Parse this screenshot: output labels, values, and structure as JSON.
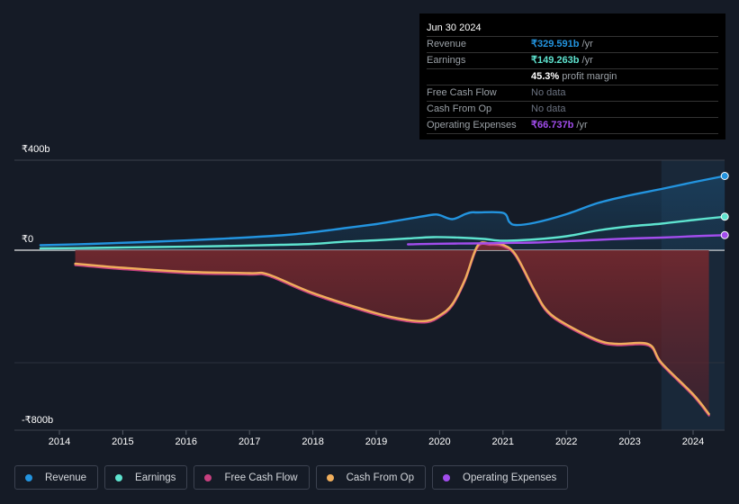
{
  "tooltip": {
    "date": "Jun 30 2024",
    "rows": [
      {
        "label": "Revenue",
        "value": "₹329.591b",
        "suffix": " /yr",
        "color": "#2394df"
      },
      {
        "label": "Earnings",
        "value": "₹149.263b",
        "suffix": " /yr",
        "color": "#5ee3cf"
      },
      {
        "label": "",
        "value": "45.3%",
        "suffix": " profit margin",
        "color": "#ffffff"
      },
      {
        "label": "Free Cash Flow",
        "value": "",
        "suffix": "No data",
        "color": "#6b7280"
      },
      {
        "label": "Cash From Op",
        "value": "",
        "suffix": "No data",
        "color": "#6b7280"
      },
      {
        "label": "Operating Expenses",
        "value": "₹66.737b",
        "suffix": " /yr",
        "color": "#a24ded"
      }
    ]
  },
  "legend": [
    {
      "label": "Revenue",
      "color": "#2394df"
    },
    {
      "label": "Earnings",
      "color": "#5ee3cf"
    },
    {
      "label": "Free Cash Flow",
      "color": "#c7407f"
    },
    {
      "label": "Cash From Op",
      "color": "#f0ae5c"
    },
    {
      "label": "Operating Expenses",
      "color": "#a24ded"
    }
  ],
  "chart_data": {
    "type": "line",
    "title": "",
    "xlabel": "",
    "ylabel": "",
    "y_tick_labels": [
      "₹400b",
      "₹0",
      "-₹800b"
    ],
    "y_ticks": [
      400,
      0,
      -800
    ],
    "ylim": [
      -800,
      400
    ],
    "x_tick_labels": [
      "2014",
      "2015",
      "2016",
      "2017",
      "2018",
      "2019",
      "2020",
      "2021",
      "2022",
      "2023",
      "2024"
    ],
    "xlim": [
      2013.2,
      2024.55
    ],
    "forecast_shade_start": 2023.5,
    "grid": true,
    "series": [
      {
        "name": "Revenue",
        "color": "#2394df",
        "x": [
          2013.7,
          2014.5,
          2015.5,
          2016.5,
          2017.5,
          2018,
          2018.5,
          2019,
          2019.3,
          2019.6,
          2019.9,
          2020.0,
          2020.2,
          2020.4,
          2020.5,
          2020.6,
          2021.0,
          2021.1,
          2021.2,
          2021.5,
          2022,
          2022.5,
          2023,
          2023.5,
          2024,
          2024.5
        ],
        "values": [
          22,
          28,
          38,
          50,
          66,
          80,
          98,
          116,
          130,
          144,
          158,
          156,
          138,
          160,
          168,
          168,
          166,
          126,
          112,
          122,
          160,
          210,
          244,
          272,
          302,
          330
        ]
      },
      {
        "name": "Earnings",
        "color": "#5ee3cf",
        "x": [
          2013.7,
          2014.5,
          2015.5,
          2016.5,
          2017.5,
          2018,
          2018.5,
          2019,
          2019.5,
          2019.9,
          2020.3,
          2020.7,
          2021,
          2021.5,
          2022,
          2022.5,
          2023,
          2023.5,
          2024,
          2024.5
        ],
        "values": [
          8,
          10,
          14,
          18,
          24,
          28,
          38,
          44,
          52,
          58,
          56,
          50,
          42,
          48,
          62,
          88,
          106,
          118,
          134,
          149
        ]
      },
      {
        "name": "Operating Expenses",
        "color": "#a24ded",
        "x": [
          2019.5,
          2020,
          2020.5,
          2021,
          2021.5,
          2022,
          2022.5,
          2023,
          2023.5,
          2024,
          2024.5
        ],
        "values": [
          26,
          29,
          30,
          32,
          34,
          40,
          46,
          52,
          56,
          62,
          67
        ]
      },
      {
        "name": "Free Cash Flow",
        "color": "#c7407f",
        "x": [
          2014.25,
          2015,
          2016,
          2017,
          2017.3,
          2018,
          2019,
          2019.5,
          2019.8,
          2020.0,
          2020.2,
          2020.4,
          2020.6,
          2020.8,
          2021.0,
          2021.2,
          2021.5,
          2021.7,
          2022,
          2022.5,
          2022.8,
          2023.3,
          2023.5,
          2024.0,
          2024.25
        ],
        "values": [
          -60,
          -78,
          -96,
          -102,
          -108,
          -190,
          -280,
          -310,
          -314,
          -290,
          -240,
          -130,
          20,
          30,
          24,
          -20,
          -180,
          -270,
          -330,
          -400,
          -416,
          -418,
          -500,
          -640,
          -728
        ]
      },
      {
        "name": "Cash From Op",
        "color": "#f0ae5c",
        "x": [
          2014.25,
          2015,
          2016,
          2017,
          2017.3,
          2018,
          2019,
          2019.5,
          2019.8,
          2020.0,
          2020.2,
          2020.4,
          2020.6,
          2020.8,
          2021.0,
          2021.2,
          2021.5,
          2021.7,
          2022,
          2022.5,
          2022.8,
          2023.3,
          2023.5,
          2024.0,
          2024.25
        ],
        "values": [
          -60,
          -78,
          -96,
          -102,
          -108,
          -190,
          -280,
          -310,
          -314,
          -290,
          -240,
          -130,
          20,
          30,
          24,
          -20,
          -180,
          -270,
          -330,
          -400,
          -416,
          -418,
          -500,
          -640,
          -728
        ]
      }
    ]
  }
}
